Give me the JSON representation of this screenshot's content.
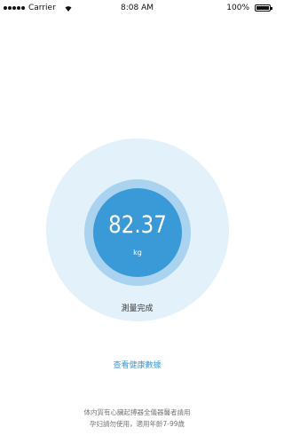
{
  "status_bar": {
    "carrier": "Carrier",
    "time": "8:08 AM",
    "battery": "100%",
    "icons": [
      "signal-icon",
      "wifi-icon",
      "battery-icon"
    ]
  },
  "gauge": {
    "value": "82.37",
    "unit": "kg",
    "colors": {
      "outer_ring": "#e3f1fa",
      "middle_ring": "#a9d3ef",
      "inner_circle": "#3a9ad8"
    }
  },
  "measurement_status": "測量完成",
  "health_link": "查看健康數據",
  "disclaimer": {
    "line1": "体内質有心臟起搏器全儀器醫者請用",
    "line2": "孕妇請勿使用，適用年齡7-99歲"
  }
}
